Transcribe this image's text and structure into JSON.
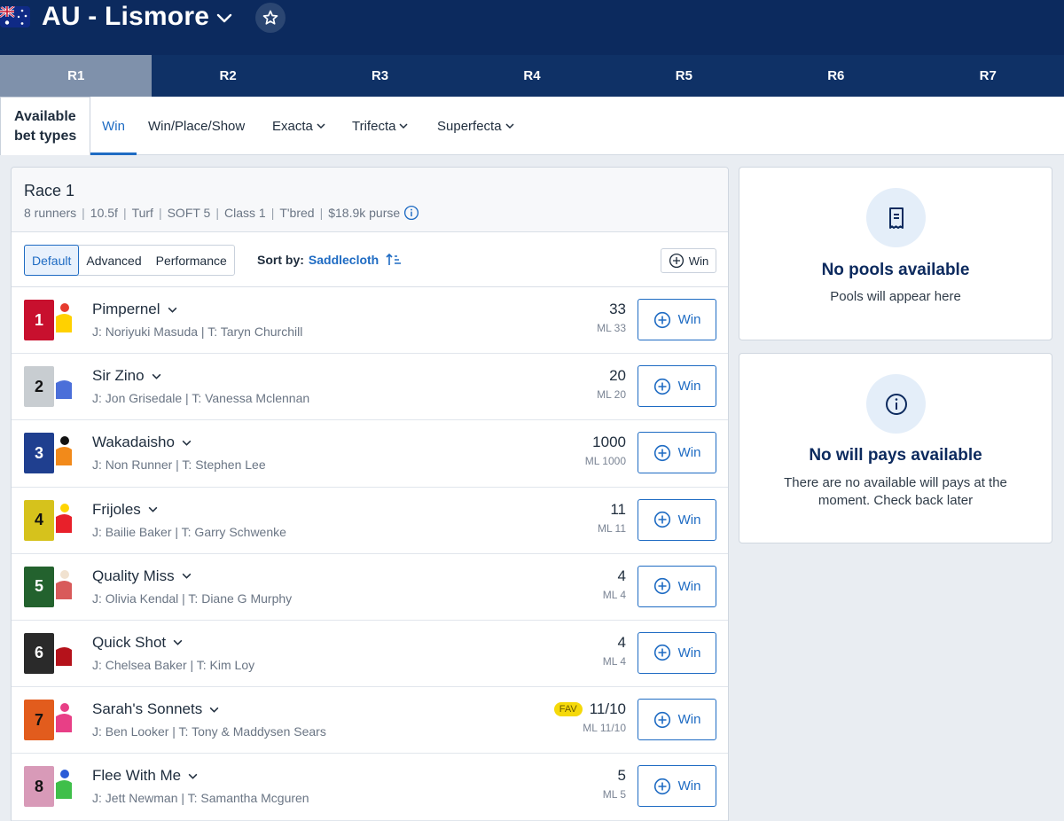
{
  "header": {
    "title": "AU - Lismore",
    "flag_icon": "australia-flag-icon",
    "favorite_icon": "star-icon",
    "colors": {
      "background": "#0c2a5e",
      "accent": "#1e6bc3"
    }
  },
  "race_tabs": [
    {
      "label": "R1",
      "active": true
    },
    {
      "label": "R2"
    },
    {
      "label": "R3"
    },
    {
      "label": "R4"
    },
    {
      "label": "R5"
    },
    {
      "label": "R6"
    },
    {
      "label": "R7"
    }
  ],
  "bet_types": {
    "label_line1": "Available",
    "label_line2": "bet types",
    "items": [
      {
        "label": "Win",
        "active": true
      },
      {
        "label": "Win/Place/Show"
      },
      {
        "label": "Exacta",
        "dropdown": true
      },
      {
        "label": "Trifecta",
        "dropdown": true
      },
      {
        "label": "Superfecta",
        "dropdown": true
      }
    ]
  },
  "race": {
    "name": "Race 1",
    "meta": [
      "8 runners",
      "10.5f",
      "Turf",
      "SOFT 5",
      "Class 1",
      "T'bred",
      "$18.9k purse"
    ],
    "views": [
      "Default",
      "Advanced",
      "Performance"
    ],
    "sort_label": "Sort by:",
    "sort_value": "Saddlecloth",
    "mini_win_label": "Win"
  },
  "runners": [
    {
      "num": "1",
      "name": "Pimpernel",
      "people": "J: Noriyuki Masuda | T: Taryn Churchill",
      "odds": "33",
      "ml": "ML 33",
      "cloth": "#c8102e",
      "num_color": "#ffffff",
      "silk": [
        "#ffd100",
        "#e63b2e"
      ],
      "win": "Win"
    },
    {
      "num": "2",
      "name": "Sir Zino",
      "people": "J: Jon Grisedale | T: Vanessa Mclennan",
      "odds": "20",
      "ml": "ML 20",
      "cloth": "#c8cdd1",
      "num_color": "#111111",
      "silk": [
        "#4b6fd9",
        "#ffffff"
      ],
      "win": "Win"
    },
    {
      "num": "3",
      "name": "Wakadaisho",
      "people": "J: Non Runner | T: Stephen Lee",
      "odds": "1000",
      "ml": "ML 1000",
      "cloth": "#1f3f8f",
      "num_color": "#ffffff",
      "silk": [
        "#f28a1a",
        "#111111"
      ],
      "win": "Win"
    },
    {
      "num": "4",
      "name": "Frijoles",
      "people": "J: Bailie Baker | T: Garry Schwenke",
      "odds": "11",
      "ml": "ML 11",
      "cloth": "#d6c21c",
      "num_color": "#111111",
      "silk": [
        "#e8202a",
        "#ffd400"
      ],
      "win": "Win"
    },
    {
      "num": "5",
      "name": "Quality Miss",
      "people": "J: Olivia Kendal | T: Diane G Murphy",
      "odds": "4",
      "ml": "ML 4",
      "cloth": "#23622e",
      "num_color": "#ffffff",
      "silk": [
        "#d85a5a",
        "#f1e2d0"
      ],
      "win": "Win"
    },
    {
      "num": "6",
      "name": "Quick Shot",
      "people": "J: Chelsea Baker | T: Kim Loy",
      "odds": "4",
      "ml": "ML 4",
      "cloth": "#2a2a2a",
      "num_color": "#ffffff",
      "silk": [
        "#b5121b",
        "#ffffff"
      ],
      "win": "Win"
    },
    {
      "num": "7",
      "name": "Sarah's Sonnets",
      "people": "J: Ben Looker | T: Tony & Maddysen Sears",
      "odds": "11/10",
      "ml": "ML 11/10",
      "fav": "FAV",
      "cloth": "#e25c1d",
      "num_color": "#111111",
      "silk": [
        "#e83f86",
        "#e83f86"
      ],
      "win": "Win"
    },
    {
      "num": "8",
      "name": "Flee With Me",
      "people": "J: Jett Newman | T: Samantha Mcguren",
      "odds": "5",
      "ml": "ML 5",
      "cloth": "#d89ab8",
      "num_color": "#111111",
      "silk": [
        "#3fbf4a",
        "#2a5bd7"
      ],
      "win": "Win"
    }
  ],
  "pools_panel": {
    "title": "No pools available",
    "text": "Pools will appear here",
    "icon": "receipt-icon"
  },
  "willpays_panel": {
    "title": "No will pays available",
    "text_line1": "There are no available will pays at the",
    "text_line2": "moment. Check back later",
    "icon": "info-icon"
  }
}
